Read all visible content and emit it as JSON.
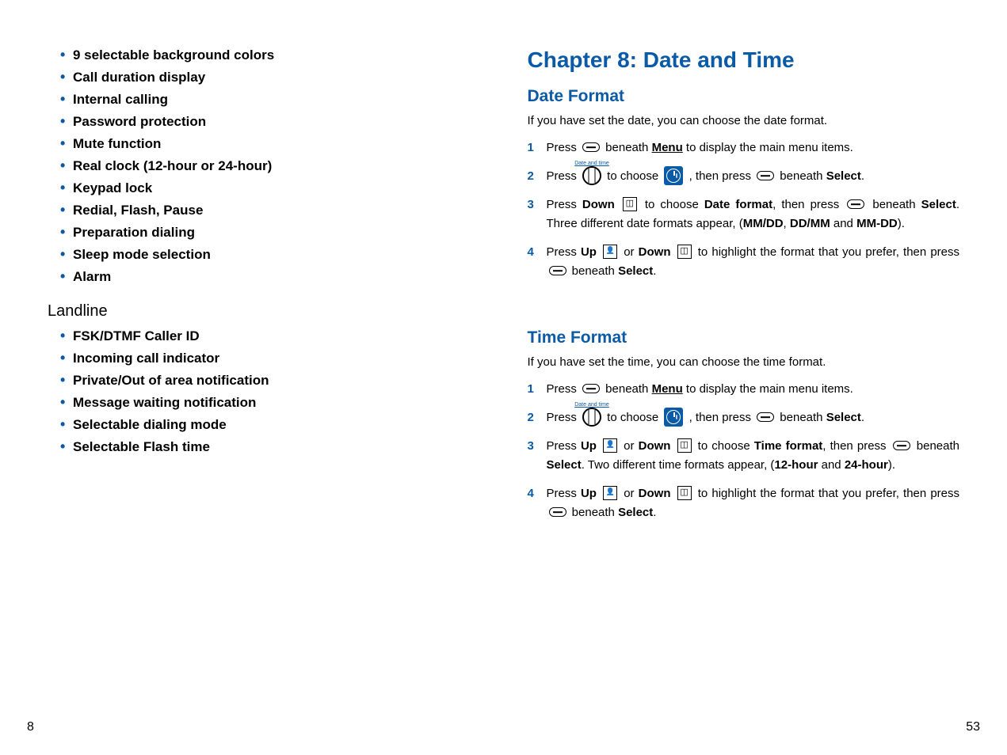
{
  "left": {
    "features": [
      "9 selectable background colors",
      "Call duration display",
      "Internal calling",
      "Password protection",
      "Mute function",
      "Real clock (12-hour or 24-hour)",
      "Keypad lock",
      "Redial, Flash, Pause",
      "Preparation dialing",
      "Sleep mode selection",
      "Alarm"
    ],
    "landline_heading": "Landline",
    "landline": [
      "FSK/DTMF Caller ID",
      "Incoming call indicator",
      "Private/Out of area notification",
      "Message waiting notification",
      "Selectable dialing mode",
      "Selectable Flash time"
    ],
    "page_num": "8"
  },
  "right": {
    "chapter_title": "Chapter 8: Date and Time",
    "date": {
      "title": "Date Format",
      "intro": "If you have set the date, you can choose the date format.",
      "icon_label": "Date and time",
      "s1_a": "Press ",
      "s1_b": " beneath ",
      "s1_menu": "Menu",
      "s1_c": " to display the main menu items.",
      "s2_a": "Press ",
      "s2_b": " to choose ",
      "s2_c": " , then press ",
      "s2_d": " beneath ",
      "s2_select": "Select",
      "s2_e": ".",
      "s3_a": "Press ",
      "s3_down": "Down",
      "s3_b": " to choose ",
      "s3_df": "Date format",
      "s3_c": ", then press ",
      "s3_d": " beneath ",
      "s3_select": "Select",
      "s3_e": ". Three different date formats appear, (",
      "s3_f1": "MM/DD",
      "s3_f_sep1": ", ",
      "s3_f2": "DD/MM",
      "s3_f_sep2": " and ",
      "s3_f3": "MM-DD",
      "s3_f_end": ").",
      "s4_a": "Press ",
      "s4_up": "Up",
      "s4_b": " or ",
      "s4_down": "Down",
      "s4_c": " to highlight the format that you prefer, then press ",
      "s4_d": " beneath ",
      "s4_select": "Select",
      "s4_e": "."
    },
    "time": {
      "title": "Time Format",
      "intro": "If you have set the time, you can choose the time format.",
      "icon_label": "Date and time",
      "s1_a": "Press ",
      "s1_b": " beneath ",
      "s1_menu": "Menu",
      "s1_c": " to display the main menu items.",
      "s2_a": "Press ",
      "s2_b": " to choose ",
      "s2_c": " , then press ",
      "s2_d": " beneath ",
      "s2_select": "Select",
      "s2_e": ".",
      "s3_a": "Press ",
      "s3_up": "Up",
      "s3_b": " or ",
      "s3_down": "Down",
      "s3_c": " to choose ",
      "s3_tf": "Time format",
      "s3_d": ", then press ",
      "s3_e": " beneath ",
      "s3_select": "Select",
      "s3_f": ". Two different time formats appear, (",
      "s3_fmt1": "12-hour",
      "s3_g": " and ",
      "s3_fmt2": "24-hour",
      "s3_h": ").",
      "s4_a": "Press ",
      "s4_up": "Up",
      "s4_b": " or ",
      "s4_down": "Down",
      "s4_c": " to highlight the format that you prefer, then press ",
      "s4_d": " beneath ",
      "s4_select": "Select",
      "s4_e": "."
    },
    "page_num": "53"
  }
}
